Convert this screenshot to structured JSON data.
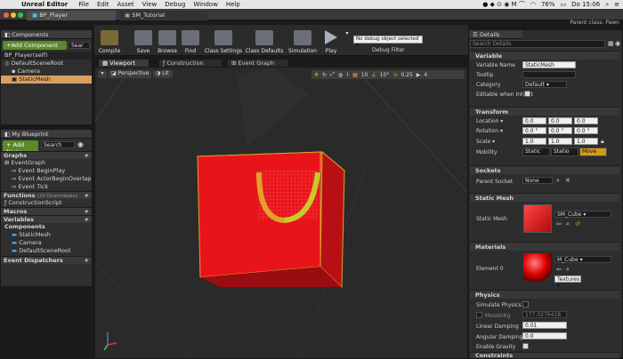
{
  "menubar": {
    "app": "Unreal Editor",
    "items": [
      "File",
      "Edit",
      "Asset",
      "View",
      "Debug",
      "Window",
      "Help"
    ],
    "battery": "76%",
    "clock": "Do 15:06"
  },
  "titlebar": {
    "tabs": [
      "BP_Player",
      "SM_Tutorial"
    ],
    "parent_class": "Parent class: Pawn"
  },
  "components": {
    "tab": "Components",
    "add_button": "+Add Component",
    "search_placeholder": "Sear",
    "root_item": "BP_Player(self)",
    "items": [
      "DefaultSceneRoot",
      "Camera",
      "StaticMesh"
    ]
  },
  "blueprint": {
    "tab": "My Blueprint",
    "add_new": "+ Add New",
    "search_placeholder": "Search",
    "graphs_label": "Graphs",
    "event_graph": "EventGraph",
    "events": [
      "Event BeginPlay",
      "Event ActorBeginOverlap",
      "Event Tick"
    ],
    "functions_label": "Functions",
    "functions_note": "(20 Overridable)",
    "construction": "ConstructionScript",
    "macros_label": "Macros",
    "variables_label": "Variables",
    "components_label": "Components",
    "component_vars": [
      "StaticMesh",
      "Camera",
      "DefaultSceneRoot"
    ],
    "dispatchers_label": "Event Dispatchers"
  },
  "toolbar": {
    "buttons": [
      "Compile",
      "Save",
      "Browse",
      "Find",
      "Class Settings",
      "Class Defaults",
      "Simulation",
      "Play"
    ],
    "debug_select": "No debug object selected",
    "debug_label": "Debug Filter"
  },
  "viewport": {
    "tabs": [
      "Viewport",
      "Construction Script",
      "Event Graph"
    ],
    "perspective": "Perspective",
    "lit": "Lit",
    "grid_snap": "10",
    "rot_snap": "10°",
    "scale_snap": "0.25",
    "cam_speed": "4"
  },
  "details": {
    "tab": "Details",
    "search_placeholder": "Search Details",
    "variable_section": "Variable",
    "variable_name_label": "Variable Name",
    "variable_name": "StaticMesh",
    "tooltip_label": "Tooltip",
    "category_label": "Category",
    "category_value": "Default",
    "editable_label": "Editable when Inherit",
    "transform_section": "Transform",
    "location_label": "Location",
    "location": [
      "0.0",
      "0.0",
      "0.0"
    ],
    "rotation_label": "Rotation",
    "rotation": [
      "0.0 °",
      "0.0 °",
      "0.0 °"
    ],
    "scale_label": "Scale",
    "scale": [
      "1.0",
      "1.0",
      "1.0"
    ],
    "mobility_label": "Mobility",
    "mobility_options": [
      "Static",
      "Statio",
      "Move"
    ],
    "sockets_section": "Sockets",
    "parent_socket_label": "Parent Socket",
    "parent_socket_value": "None",
    "static_mesh_section": "Static Mesh",
    "static_mesh_label": "Static Mesh",
    "static_mesh_value": "SM_Cube",
    "materials_section": "Materials",
    "element0_label": "Element 0",
    "material_value": "M_Cube",
    "textures_button": "Textures",
    "physics_section": "Physics",
    "simulate_physics_label": "Simulate Physics",
    "mass_label": "MassInKg",
    "mass_value": "177.0276418",
    "linear_damping_label": "Linear Damping",
    "linear_damping": "0.01",
    "angular_damping_label": "Angular Damping",
    "angular_damping": "0.0",
    "enable_gravity_label": "Enable Gravity",
    "constraints_section": "Constraints"
  },
  "colors": {
    "cube": "#e8141a",
    "handle": "#e0a22a",
    "accent_green": "#5a8a2a",
    "move_active": "#d39b19"
  }
}
